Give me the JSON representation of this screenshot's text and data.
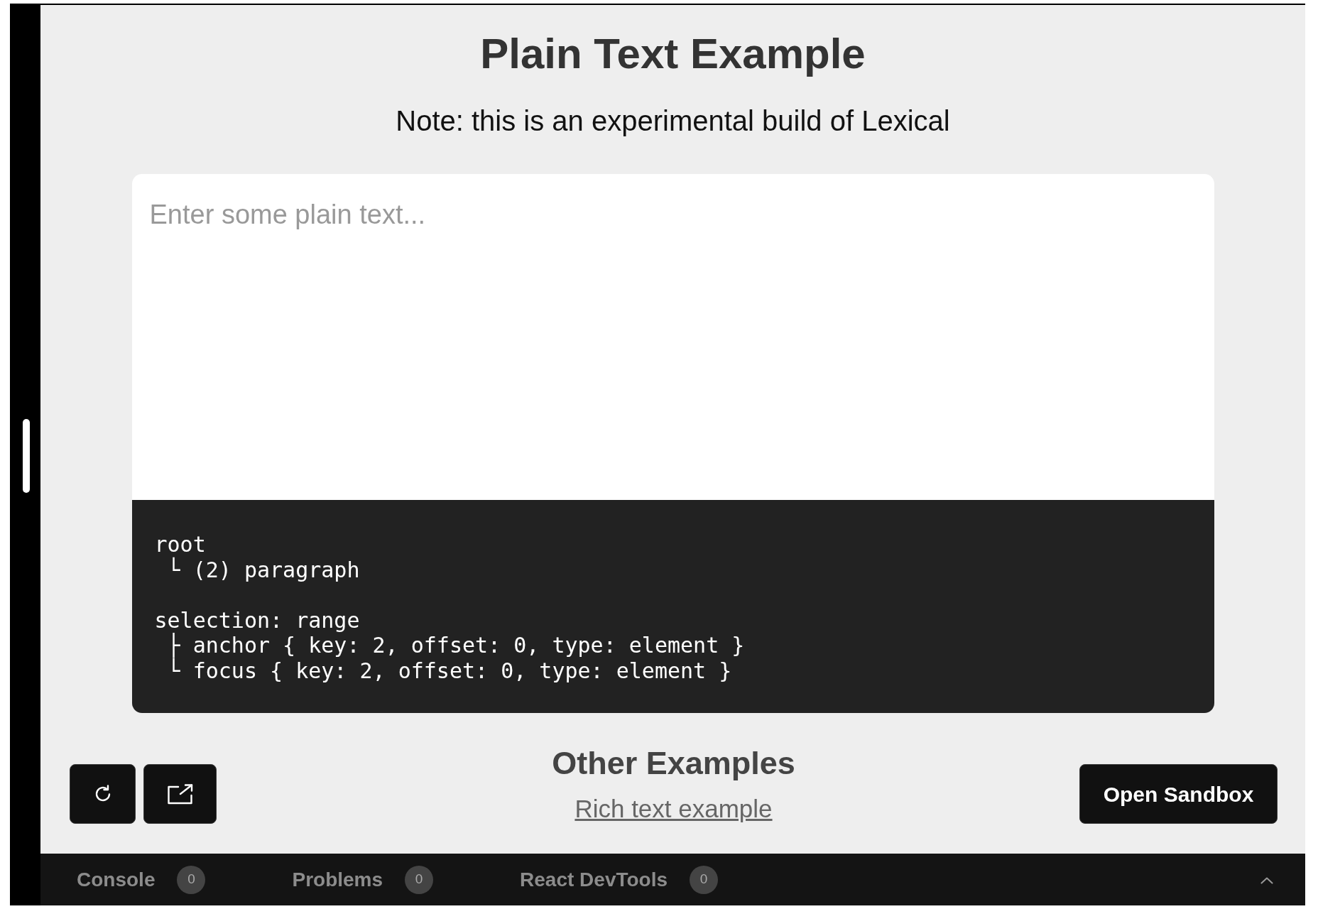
{
  "page": {
    "title": "Plain Text Example",
    "note": "Note: this is an experimental build of Lexical"
  },
  "editor": {
    "placeholder": "Enter some plain text...",
    "tree_view": {
      "sections": [
        {
          "items": [
            {
              "text": "root",
              "children": [
                {
                  "text": "└ (2) paragraph"
                }
              ]
            }
          ]
        },
        {
          "items": [
            {
              "text": "selection: range",
              "children": [
                {
                  "text": "├ anchor { key: 2, offset: 0, type: element }"
                },
                {
                  "text": "└ focus { key: 2, offset: 0, type: element }"
                }
              ]
            }
          ]
        }
      ]
    }
  },
  "actions": {
    "icon_buttons": [
      {
        "kind": "refresh"
      },
      {
        "kind": "external"
      }
    ],
    "other_examples": {
      "heading": "Other Examples",
      "links": [
        "Rich text example"
      ]
    },
    "sandbox_button": "Open Sandbox"
  },
  "bottom_panel": {
    "expanded": false,
    "tabs": [
      {
        "label": "Console",
        "count": "0",
        "selected": false
      },
      {
        "label": "Problems",
        "count": "0",
        "selected": false
      },
      {
        "label": "React DevTools",
        "count": "0",
        "selected": false
      }
    ]
  }
}
